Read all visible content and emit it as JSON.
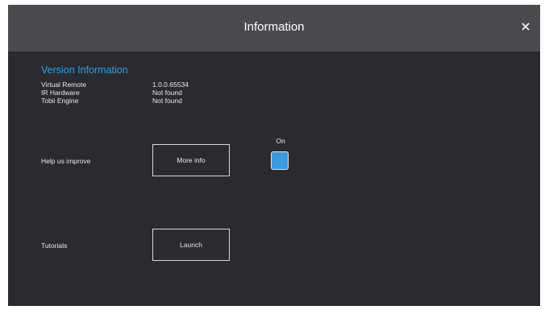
{
  "dialog": {
    "title": "Information",
    "close_icon": "close-icon"
  },
  "version_info": {
    "heading": "Version Information",
    "rows": [
      {
        "label": "Virtual Remote",
        "value": "1.0.0.65534"
      },
      {
        "label": "IR Hardware",
        "value": "Not found"
      },
      {
        "label": "Tobii Engine",
        "value": "Not found"
      }
    ]
  },
  "help_improve": {
    "label": "Help us improve",
    "button_label": "More info",
    "toggle_label": "On",
    "toggle_checked": true,
    "toggle_color": "#3a9be0"
  },
  "tutorials": {
    "label": "Tutorials",
    "button_label": "Launch"
  },
  "colors": {
    "background": "#2b2a2f",
    "titlebar": "#4a494d",
    "accent": "#2f9fe0"
  }
}
